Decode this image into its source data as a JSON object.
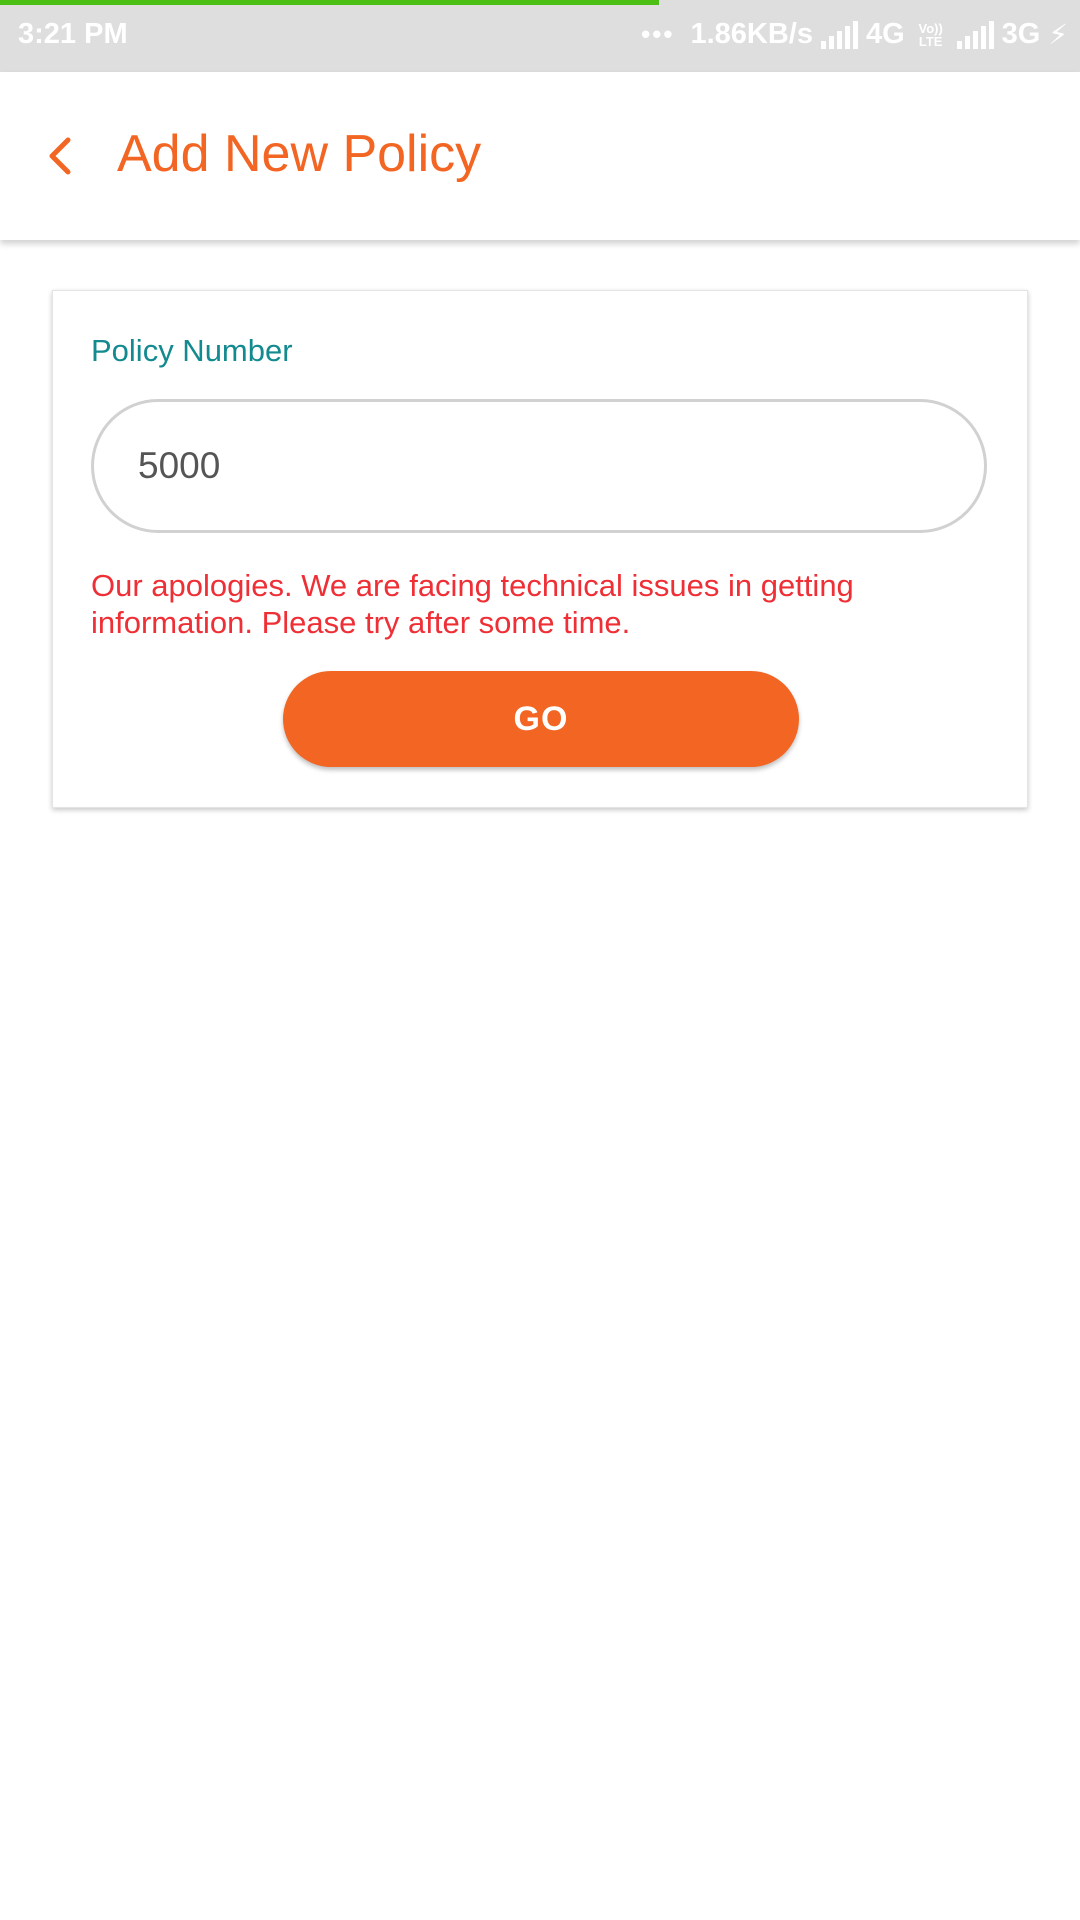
{
  "status_bar": {
    "time": "3:21 PM",
    "dots": "•••",
    "speed": "1.86KB/s",
    "net1": "4G",
    "volte_top": "Vo))",
    "volte_bottom": "LTE",
    "net2": "3G",
    "progress_fraction": 0.61,
    "progress_color": "#4cbf15",
    "background_color": "#dedede"
  },
  "header": {
    "back_icon": "chevron-left-icon",
    "title": "Add New Policy",
    "accent_color": "#f26522"
  },
  "form": {
    "policy_label": "Policy Number",
    "policy_value": "5000",
    "label_color": "#128a8f",
    "error_message": "Our apologies. We are facing technical issues in getting information. Please try after some time.",
    "error_color": "#ef2f36",
    "go_label": "GO"
  }
}
